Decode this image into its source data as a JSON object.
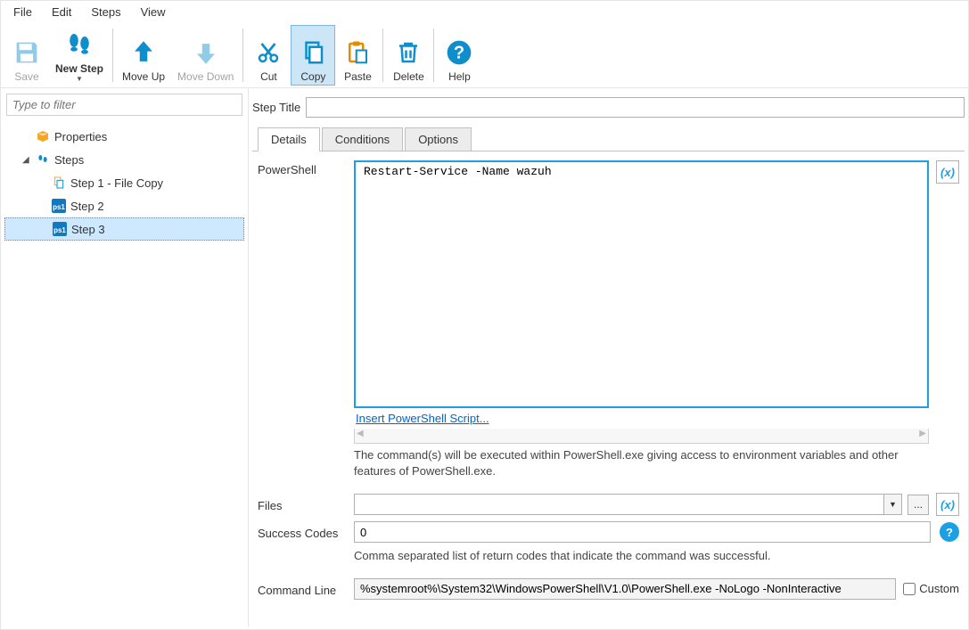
{
  "menu": [
    "File",
    "Edit",
    "Steps",
    "View"
  ],
  "toolbar": {
    "save": "Save",
    "new_step": "New Step",
    "move_up": "Move Up",
    "move_down": "Move Down",
    "cut": "Cut",
    "copy": "Copy",
    "paste": "Paste",
    "delete": "Delete",
    "help": "Help"
  },
  "filter_placeholder": "Type to filter",
  "tree": {
    "properties": "Properties",
    "steps": "Steps",
    "items": [
      "Step 1 - File Copy",
      "Step 2",
      "Step 3"
    ]
  },
  "step_title_label": "Step Title",
  "step_title_value": "",
  "tabs": [
    "Details",
    "Conditions",
    "Options"
  ],
  "details": {
    "powershell_label": "PowerShell",
    "powershell_script": "Restart-Service -Name wazuh",
    "insert_link": "Insert PowerShell Script...",
    "run_hint": "The command(s) will be executed within PowerShell.exe giving access to environment variables and other features of PowerShell.exe.",
    "files_label": "Files",
    "files_value": "",
    "browse_label": "...",
    "success_label": "Success Codes",
    "success_value": "0",
    "success_hint": "Comma separated list of return codes that indicate the command was successful.",
    "command_label": "Command Line",
    "command_value": "%systemroot%\\System32\\WindowsPowerShell\\V1.0\\PowerShell.exe -NoLogo -NonInteractive",
    "custom_label": "Custom"
  }
}
